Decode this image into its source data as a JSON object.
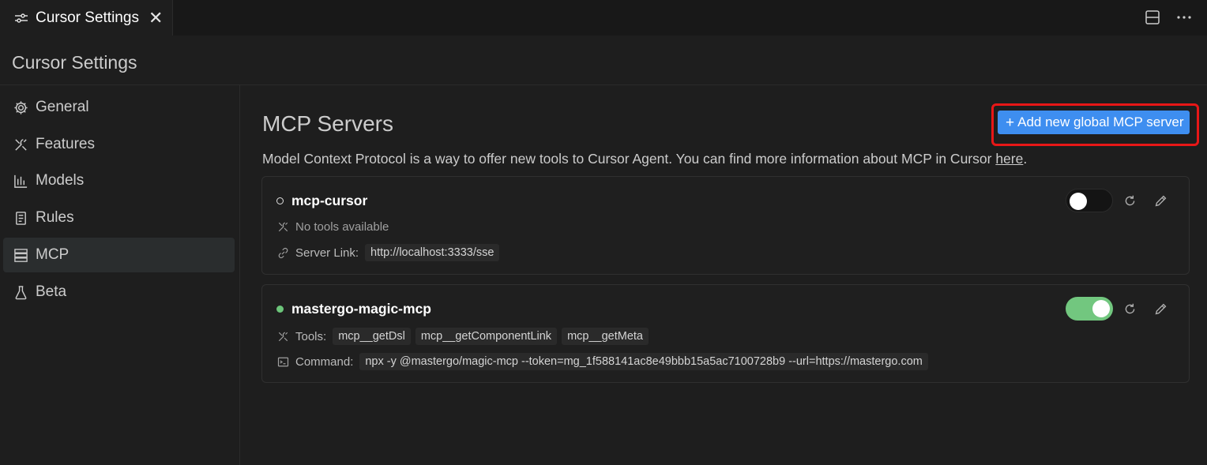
{
  "tab": {
    "title": "Cursor Settings",
    "close_glyph": "✕",
    "icon": "settings-sliders-icon"
  },
  "toolbar": {
    "layout_icon": "split-layout-icon",
    "more_icon": "more-icon"
  },
  "header": {
    "title": "Cursor Settings"
  },
  "sidebar": {
    "items": [
      {
        "label": "General",
        "icon": "gear-icon",
        "active": false
      },
      {
        "label": "Features",
        "icon": "tools-icon",
        "active": false
      },
      {
        "label": "Models",
        "icon": "bar-chart-icon",
        "active": false
      },
      {
        "label": "Rules",
        "icon": "document-icon",
        "active": false
      },
      {
        "label": "MCP",
        "icon": "server-icon",
        "active": true
      },
      {
        "label": "Beta",
        "icon": "flask-icon",
        "active": false
      }
    ]
  },
  "main": {
    "title": "MCP Servers",
    "add_button": {
      "plus": "+",
      "label": "Add new global MCP server"
    },
    "description": "Model Context Protocol is a way to offer new tools to Cursor Agent. You can find more information about MCP in Cursor ",
    "description_link": "here",
    "description_end": ".",
    "servers": [
      {
        "name": "mcp-cursor",
        "enabled": false,
        "tools_text": "No tools available",
        "link_label": "Server Link:",
        "link_value": "http://localhost:3333/sse"
      },
      {
        "name": "mastergo-magic-mcp",
        "enabled": true,
        "tools_label": "Tools:",
        "tools": [
          "mcp__getDsl",
          "mcp__getComponentLink",
          "mcp__getMeta"
        ],
        "command_label": "Command:",
        "command_value": "npx -y @mastergo/magic-mcp --token=mg_1f588141ac8e49bbb15a5ac7100728b9 --url=https://mastergo.com"
      }
    ]
  },
  "colors": {
    "accent": "#3e8ef0",
    "toggle_on": "#72c77f",
    "highlight": "#e81717"
  }
}
